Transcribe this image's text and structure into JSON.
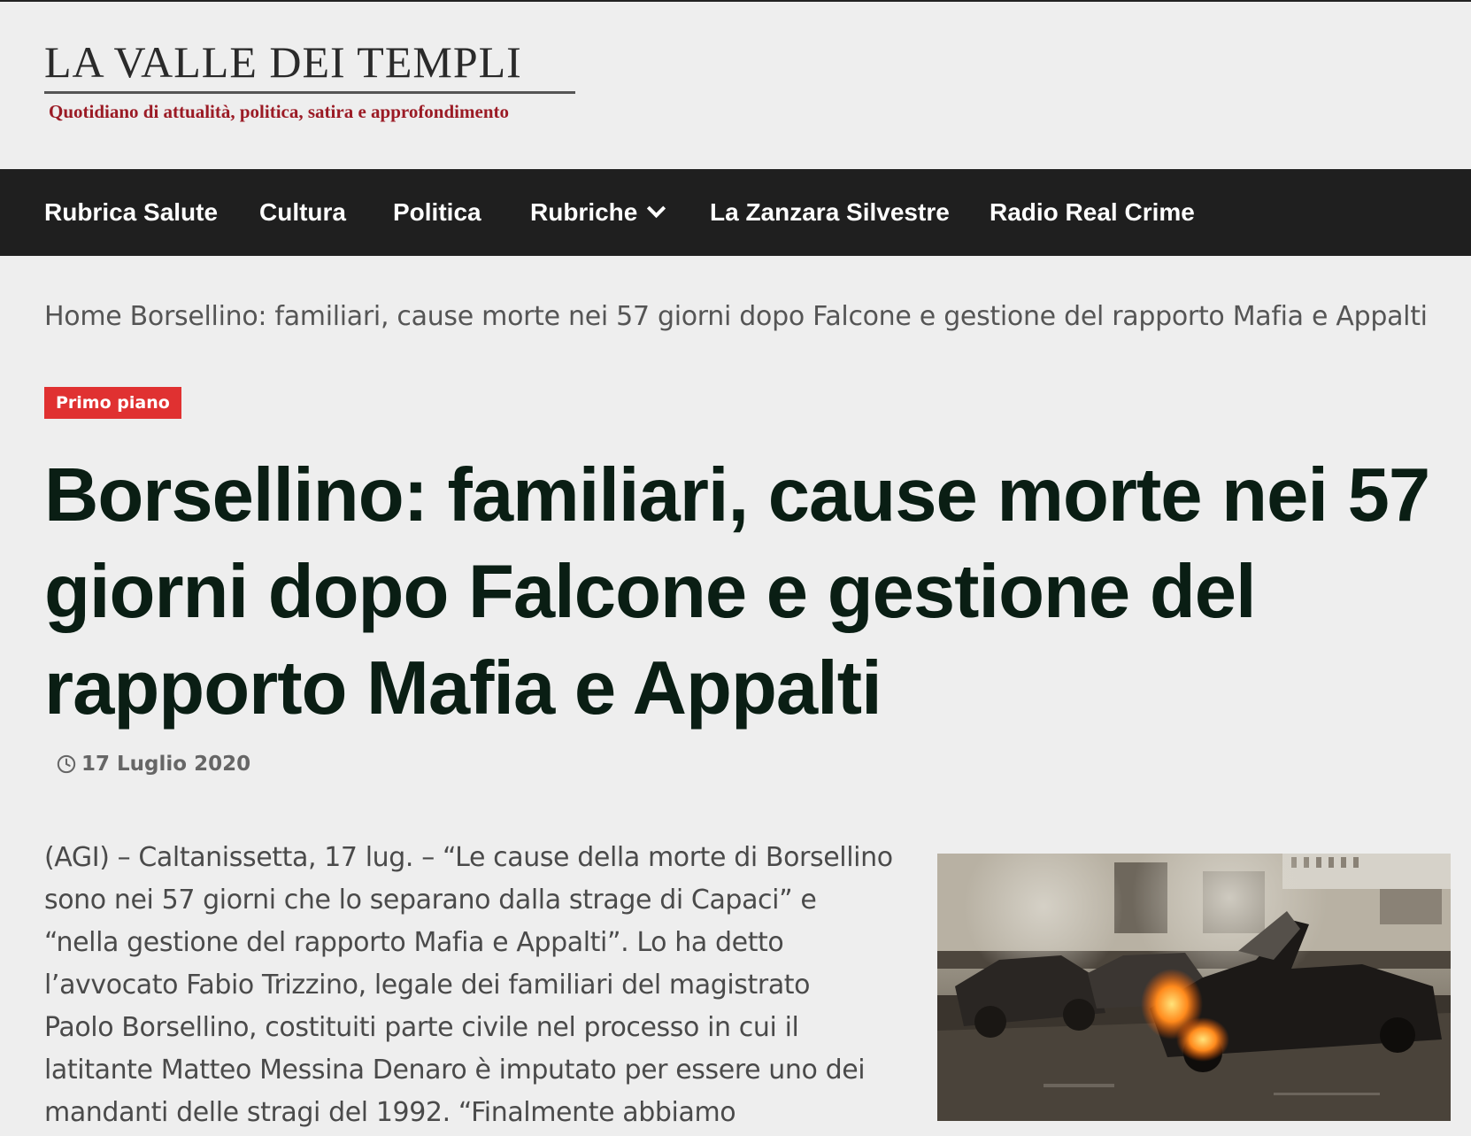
{
  "logo": {
    "title": "LA VALLE DEI TEMPLI",
    "subtitle": "Quotidiano di attualità, politica, satira e approfondimento"
  },
  "nav": {
    "items": [
      {
        "label": "Rubrica Salute"
      },
      {
        "label": "Cultura"
      },
      {
        "label": "Politica"
      },
      {
        "label": "Rubriche",
        "has_dropdown": true
      },
      {
        "label": "La Zanzara Silvestre"
      },
      {
        "label": "Radio Real Crime"
      }
    ]
  },
  "breadcrumb": {
    "home": "Home",
    "current": "Borsellino: familiari, cause morte nei 57 giorni dopo Falcone e gestione del rapporto Mafia e Appalti"
  },
  "article": {
    "category": "Primo piano",
    "title_lines": [
      "Borsellino: familiari, cause morte nei 57",
      "giorni dopo Falcone e gestione del",
      "rapporto Mafia e Appalti"
    ],
    "date": "17 Luglio 2020",
    "body_lines": [
      "(AGI) – Caltanissetta, 17 lug. – “Le cause della morte di Borsellino",
      "sono nei 57 giorni che lo separano dalla strage di Capaci” e",
      "“nella gestione del rapporto Mafia e Appalti”. Lo ha detto",
      "l’avvocato Fabio Trizzino, legale dei familiari del magistrato",
      "Paolo Borsellino, costituiti parte civile nel processo in cui il",
      "latitante Matteo Messina Denaro è imputato per essere uno dei",
      "mandanti delle stragi del 1992. “Finalmente abbiamo"
    ]
  },
  "colors": {
    "background": "#eeeeee",
    "navbar": "#1f1f1f",
    "badge": "#e03131",
    "title": "#0a1e14",
    "logo_subtitle": "#9b1b25"
  }
}
